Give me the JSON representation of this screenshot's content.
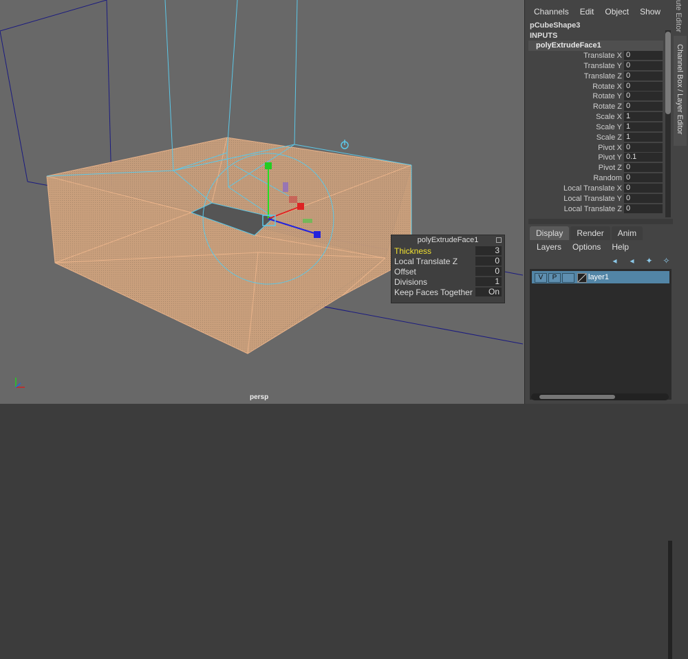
{
  "viewport": {
    "camera_label": "persp",
    "axis_icon": "axis-gizmo-icon",
    "pivot_icon": "pivot-icon"
  },
  "channel_box": {
    "menu": [
      "Channels",
      "Edit",
      "Object",
      "Show"
    ],
    "object_name": "pCubeShape3",
    "inputs_label": "INPUTS",
    "node_name": "polyExtrudeFace1",
    "channels": [
      {
        "label": "Translate X",
        "value": "0"
      },
      {
        "label": "Translate Y",
        "value": "0"
      },
      {
        "label": "Translate Z",
        "value": "0"
      },
      {
        "label": "Rotate X",
        "value": "0"
      },
      {
        "label": "Rotate Y",
        "value": "0"
      },
      {
        "label": "Rotate Z",
        "value": "0"
      },
      {
        "label": "Scale X",
        "value": "1"
      },
      {
        "label": "Scale Y",
        "value": "1"
      },
      {
        "label": "Scale Z",
        "value": "1"
      },
      {
        "label": "Pivot X",
        "value": "0"
      },
      {
        "label": "Pivot Y",
        "value": "0.1"
      },
      {
        "label": "Pivot Z",
        "value": "0"
      },
      {
        "label": "Random",
        "value": "0"
      },
      {
        "label": "Local Translate X",
        "value": "0"
      },
      {
        "label": "Local Translate Y",
        "value": "0"
      },
      {
        "label": "Local Translate Z",
        "value": "0"
      }
    ],
    "side_tab": "Channel Box / Layer Editor",
    "side_tab_prev": "ute Editor"
  },
  "layer_editor": {
    "tabs": [
      "Display",
      "Render",
      "Anim"
    ],
    "active_tab": "Display",
    "menu": [
      "Layers",
      "Options",
      "Help"
    ],
    "layer": {
      "visible": "V",
      "playback": "P",
      "name": "layer1"
    }
  },
  "extrude_hud": {
    "title": "polyExtrudeFace1",
    "rows": [
      {
        "label": "Thickness",
        "value": "3",
        "highlight": true
      },
      {
        "label": "Local Translate Z",
        "value": "0"
      },
      {
        "label": "Offset",
        "value": "0"
      },
      {
        "label": "Divisions",
        "value": "1"
      },
      {
        "label": "Keep Faces Together",
        "value": "On"
      }
    ]
  },
  "colors": {
    "viewport_bg": "#686868",
    "mesh_fill": "#c8a07a",
    "wireframe_orange": "#e6b48c",
    "selection_cyan": "#5cc8e8",
    "highlight_text": "#f0e030",
    "layer_selected": "#5285a6"
  }
}
